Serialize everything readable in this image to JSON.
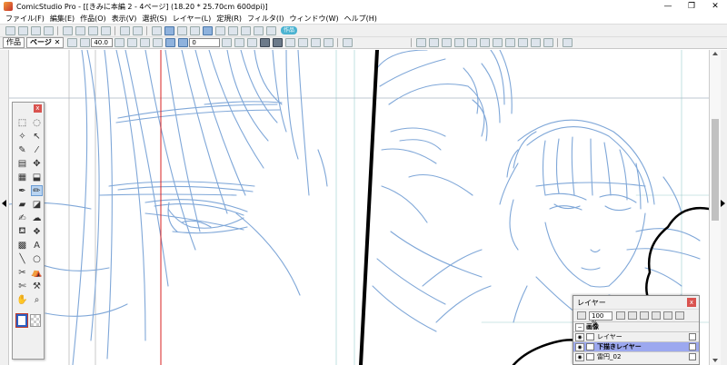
{
  "window": {
    "title": "ComicStudio Pro - [[きみに本編 2 - 4ページ] (18.20 * 25.70cm 600dpi)]",
    "minimize": "—",
    "maximize": "❐",
    "close": "✕"
  },
  "menu": [
    "ファイル(F)",
    "編集(E)",
    "作品(O)",
    "表示(V)",
    "選択(S)",
    "レイヤー(L)",
    "定規(R)",
    "フィルタ(I)",
    "ウィンドウ(W)",
    "ヘルプ(H)"
  ],
  "toolbar": {
    "badge": "作品"
  },
  "tabs": {
    "work": "作品",
    "page": "ページ",
    "page_close": "✕"
  },
  "view": {
    "zoom": "40.0",
    "rotation": "0"
  },
  "tool_palette": {
    "close": "x",
    "tools": [
      {
        "icon": "marquee-icon",
        "glyph": "⬚"
      },
      {
        "icon": "lasso-icon",
        "glyph": "◌"
      },
      {
        "icon": "magic-wand-icon",
        "glyph": "✧"
      },
      {
        "icon": "object-select-icon",
        "glyph": "↖"
      },
      {
        "icon": "select-pen-icon",
        "glyph": "✎"
      },
      {
        "icon": "eyedropper-icon",
        "glyph": "⁄"
      },
      {
        "icon": "ruler-select-icon",
        "glyph": "▤"
      },
      {
        "icon": "move-icon",
        "glyph": "✥"
      },
      {
        "icon": "panel-ruler-icon",
        "glyph": "▦"
      },
      {
        "icon": "layer-move-icon",
        "glyph": "⬓"
      },
      {
        "icon": "pen-icon",
        "glyph": "✒"
      },
      {
        "icon": "pencil-icon",
        "glyph": "✏"
      },
      {
        "icon": "marker-icon",
        "glyph": "▰"
      },
      {
        "icon": "eraser-icon",
        "glyph": "◪"
      },
      {
        "icon": "brush-icon",
        "glyph": "✍"
      },
      {
        "icon": "airbrush-icon",
        "glyph": "☁"
      },
      {
        "icon": "fill-icon",
        "glyph": "⛾"
      },
      {
        "icon": "pattern-brush-icon",
        "glyph": "❖"
      },
      {
        "icon": "gradient-icon",
        "glyph": "▩"
      },
      {
        "icon": "text-icon",
        "glyph": "A"
      },
      {
        "icon": "line-icon",
        "glyph": "╲"
      },
      {
        "icon": "ellipse-icon",
        "glyph": "○"
      },
      {
        "icon": "balloon-icon",
        "glyph": "✂"
      },
      {
        "icon": "tone-scrape-icon",
        "glyph": "⛺"
      },
      {
        "icon": "panel-cut-icon",
        "glyph": "✄"
      },
      {
        "icon": "stamp-icon",
        "glyph": "⚒"
      },
      {
        "icon": "hand-icon",
        "glyph": "✋"
      },
      {
        "icon": "zoom-icon",
        "glyph": "⌕"
      }
    ]
  },
  "layer_palette": {
    "title": "レイヤー",
    "close": "x",
    "opacity": "100 %",
    "rows": [
      {
        "label": "画像",
        "kind": "folder"
      },
      {
        "label": "レイヤー",
        "kind": "layer"
      },
      {
        "label": "下描きレイヤー",
        "kind": "layer",
        "selected": true
      },
      {
        "label": "雷円_02",
        "kind": "layer"
      }
    ]
  },
  "colors": {
    "sketch_line": "#7fa7d8",
    "guide_line": "#d92020",
    "panel_border": "#000000",
    "layer_selected": "#9ca8ef",
    "tool_active": "#b9d4f1"
  }
}
